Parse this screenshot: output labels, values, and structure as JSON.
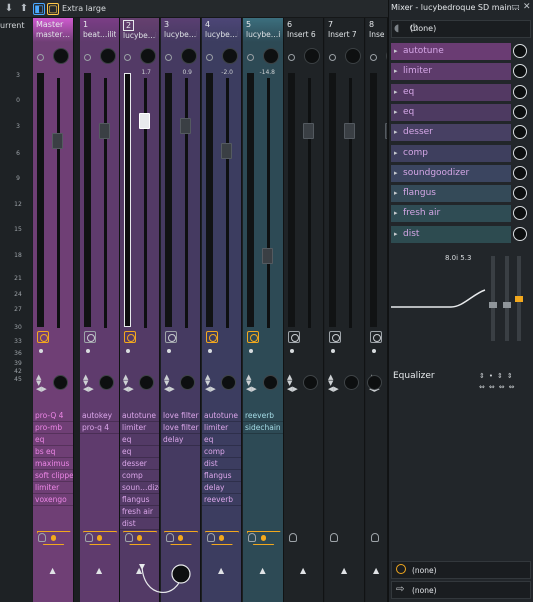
{
  "toolbar": {
    "size_label": "Extra large"
  },
  "scale": {
    "title": "urrent",
    "ticks": [
      "3",
      "0",
      "3",
      "6",
      "9",
      "12",
      "15",
      "18",
      "21",
      "24",
      "27",
      "30",
      "33",
      "36",
      "39",
      "42",
      "45"
    ]
  },
  "strips": [
    {
      "num": "Master",
      "name": "master…ilith",
      "vol": "",
      "fx": [
        "pro-Q 4",
        "pro-mb",
        "eq",
        "bs eq",
        "maximus",
        "soft clipper",
        "limiter",
        "voxengo"
      ]
    },
    {
      "num": "1",
      "name": "beat…ilith",
      "vol": "",
      "fx": [
        "autokey",
        "pro-q 4"
      ]
    },
    {
      "num": "2",
      "name": "lucybe…ilith",
      "vol": "1.7",
      "fx": [
        "autotune",
        "limiter",
        "eq",
        "eq",
        "desser",
        "comp",
        "soun…dizer",
        "flangus",
        "fresh air",
        "dist"
      ]
    },
    {
      "num": "3",
      "name": "lucybe…ilith",
      "vol": "0.9",
      "fx": [
        "love filter",
        "love filter",
        "delay"
      ]
    },
    {
      "num": "4",
      "name": "lucybe…ilith",
      "vol": "-2.0",
      "fx": [
        "autotune",
        "limiter",
        "eq",
        "comp",
        "dist",
        "flangus",
        "delay",
        "reeverb"
      ]
    },
    {
      "num": "5",
      "name": "lucybe…ilith",
      "vol": "-14.8",
      "fx": [
        "reeverb",
        "sidechain"
      ]
    },
    {
      "num": "6",
      "name": "Insert 6",
      "vol": "",
      "fx": []
    },
    {
      "num": "7",
      "name": "Insert 7",
      "vol": "",
      "fx": []
    },
    {
      "num": "8",
      "name": "Inse",
      "vol": "",
      "fx": []
    }
  ],
  "right_panel": {
    "title": "Mixer - lucybedroque SD main…",
    "input": "(none)",
    "slots": [
      "autotune",
      "limiter",
      "eq",
      "eq",
      "desser",
      "comp",
      "soundgoodizer",
      "flangus",
      "fresh air",
      "dist"
    ],
    "eq_readout": "8.0i 5.3",
    "eq_label": "Equalizer",
    "output_top": "(none)",
    "output_bottom": "(none)"
  },
  "colors": {
    "master": "#7a3f7a",
    "track1": "#6a3d78",
    "track2": "#5a3e72",
    "track3": "#4b3b68",
    "track4": "#3d3f66",
    "track5": "#33505e",
    "orange": "#f2a81d",
    "selected_border": "#e6e9ec"
  },
  "icons": {
    "route": "route-icon",
    "mic": "mic-icon",
    "tray": "tray-icon"
  }
}
